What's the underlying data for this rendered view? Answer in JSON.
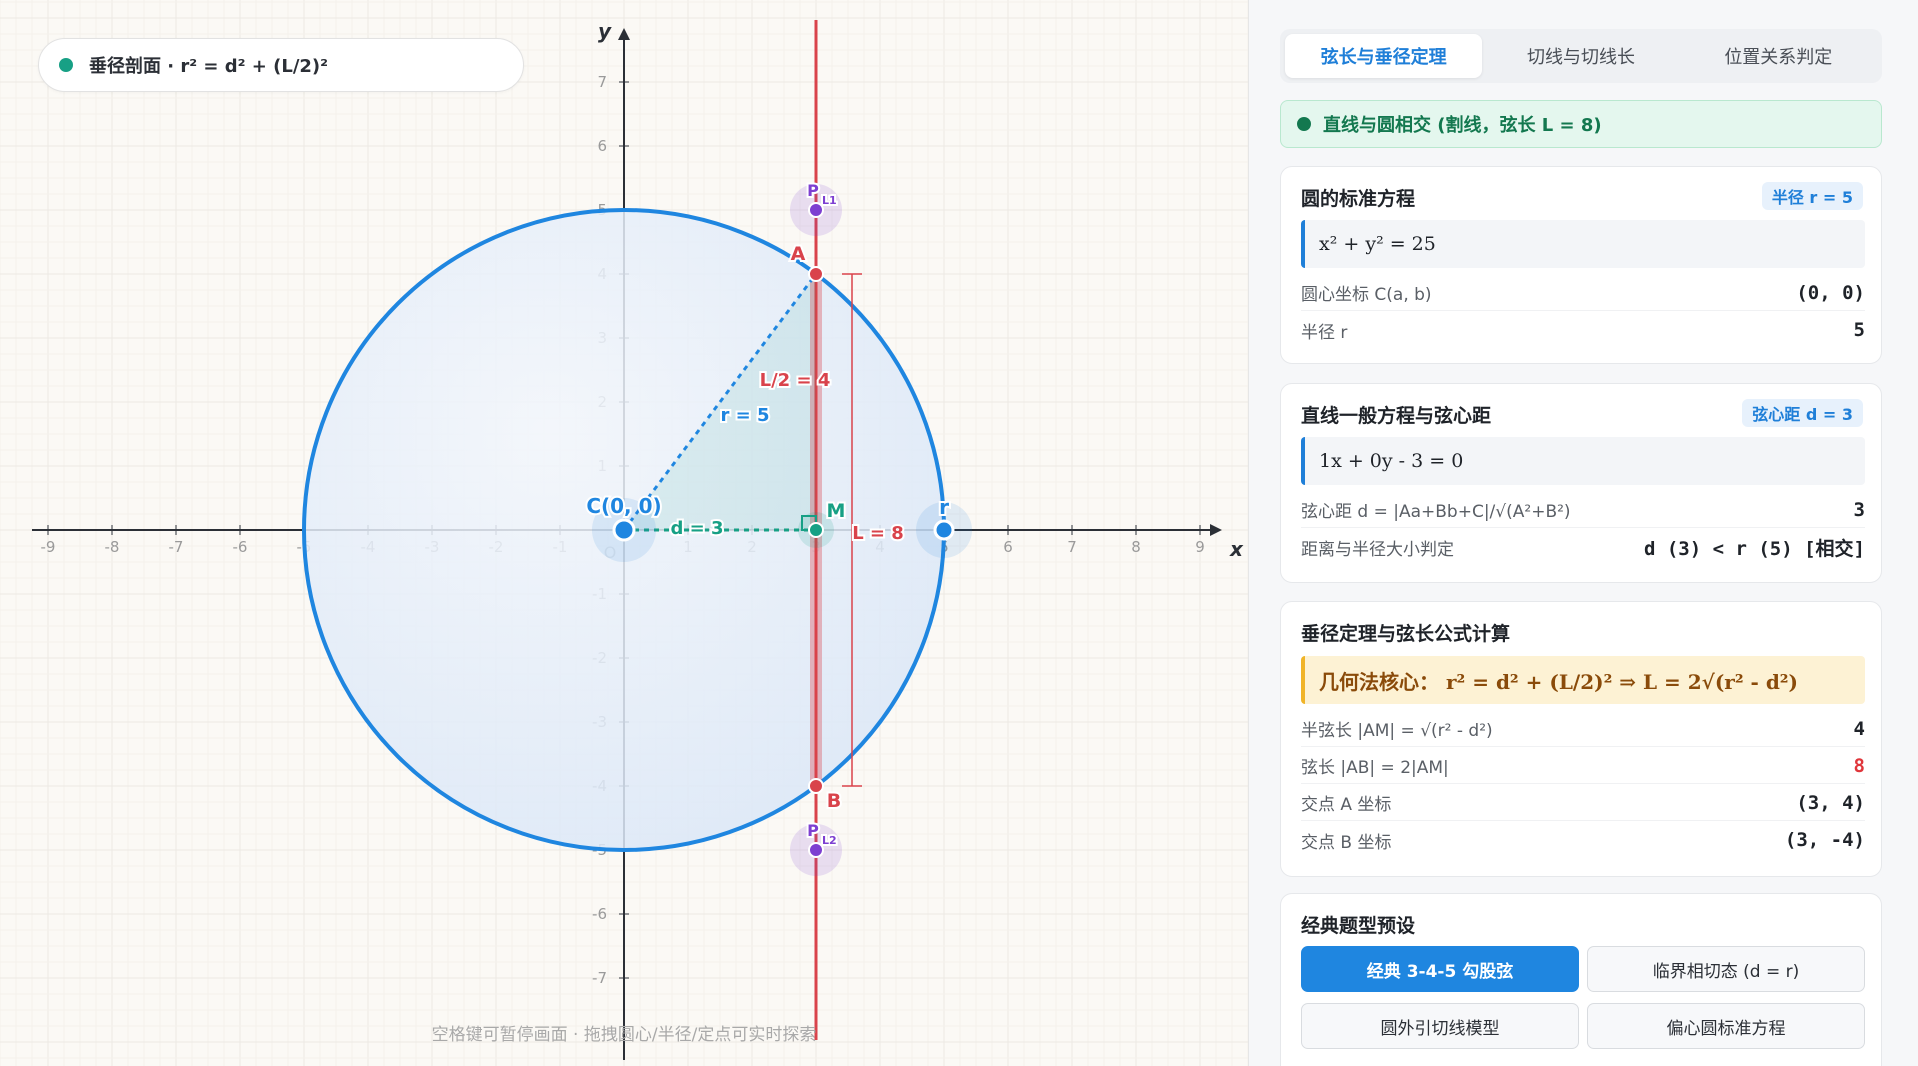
{
  "canvas": {
    "mode_label": "垂径剖面 · r² = d² + (L/2)²",
    "hint": "空格键可暂停画面 · 拖拽圆心/半径/定点可实时探索",
    "axis_x_label": "x",
    "axis_y_label": "y",
    "origin_label": "O",
    "x_ticks": [
      "-9",
      "-8",
      "-7",
      "-6",
      "-5",
      "-4",
      "-3",
      "-2",
      "-1",
      "1",
      "2",
      "3",
      "4",
      "5",
      "6",
      "7",
      "8",
      "9"
    ],
    "y_ticks": [
      "7",
      "6",
      "5",
      "4",
      "3",
      "2",
      "1",
      "-1",
      "-2",
      "-3",
      "-4",
      "-5",
      "-6",
      "-7"
    ],
    "labels": {
      "center": "C(0, 0)",
      "radius_point": "r",
      "radius": "r = 5",
      "distance": "d = 3",
      "half_chord": "L/2 = 4",
      "chord": "L = 8",
      "point_a": "A",
      "point_b": "B",
      "point_m": "M",
      "p1": "P",
      "p1_sub": "L1",
      "p2": "P",
      "p2_sub": "L2"
    },
    "colors": {
      "circle": "#1f86e0",
      "line": "#d9434b",
      "green": "#17a085",
      "purple": "#7d3fd1"
    }
  },
  "geometry": {
    "circle": {
      "cx": 0,
      "cy": 0,
      "r": 5
    },
    "line_x": 3,
    "point_a": [
      3,
      4
    ],
    "point_b": [
      3,
      -4
    ],
    "point_m": [
      3,
      0
    ],
    "p1": [
      3,
      5
    ],
    "p2": [
      3,
      -5
    ]
  },
  "panel": {
    "tabs": [
      "弦长与垂径定理",
      "切线与切线长",
      "位置关系判定"
    ],
    "status": "直线与圆相交 (割线，弦长 L = 8)",
    "card1": {
      "title": "圆的标准方程",
      "badge": "半径 r = 5",
      "formula": "x² + y² = 25",
      "rows": [
        {
          "label": "圆心坐标 C(a, b)",
          "value": "(0, 0)"
        },
        {
          "label": "半径 r",
          "value": "5"
        }
      ]
    },
    "card2": {
      "title": "直线一般方程与弦心距",
      "badge": "弦心距 d = 3",
      "formula": "1x + 0y - 3 = 0",
      "rows": [
        {
          "label": "弦心距 d = |Aa+Bb+C|/√(A²+B²)",
          "value": "3"
        },
        {
          "label": "距离与半径大小判定",
          "value": "d (3) < r (5) [相交]"
        }
      ]
    },
    "card3": {
      "title": "垂径定理与弦长公式计算",
      "formula": "几何法核心： r² = d² + (L/2)² ⇒ L = 2√(r² - d²)",
      "rows": [
        {
          "label": "半弦长 |AM| = √(r² - d²)",
          "value": "4"
        },
        {
          "label": "弦长 |AB| = 2|AM|",
          "value": "8"
        },
        {
          "label": "交点 A 坐标",
          "value": "(3, 4)"
        },
        {
          "label": "交点 B 坐标",
          "value": "(3, -4)"
        }
      ]
    },
    "card4": {
      "title": "经典题型预设",
      "buttons": [
        "经典 3-4-5 勾股弦",
        "临界相切态 (d = r)",
        "圆外引切线模型",
        "偏心圆标准方程"
      ]
    }
  }
}
